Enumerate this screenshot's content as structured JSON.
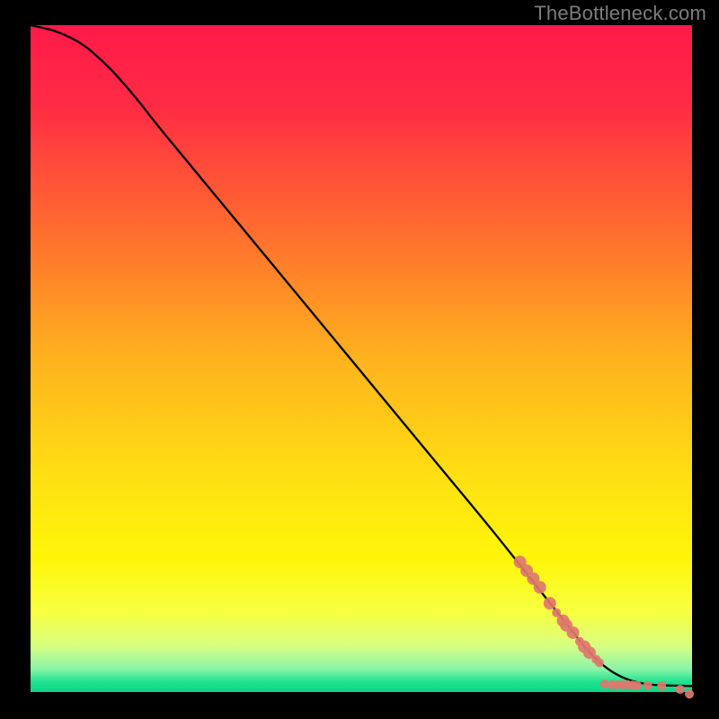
{
  "watermark": "TheBottleneck.com",
  "chart_data": {
    "type": "line",
    "title": "",
    "xlabel": "",
    "ylabel": "",
    "xlim": [
      0,
      100
    ],
    "ylim": [
      0,
      100
    ],
    "gradient_stops": [
      {
        "pos": 0.0,
        "color": "#ff1a4a"
      },
      {
        "pos": 0.12,
        "color": "#ff2b44"
      },
      {
        "pos": 0.3,
        "color": "#ff6a2f"
      },
      {
        "pos": 0.5,
        "color": "#ffb21e"
      },
      {
        "pos": 0.68,
        "color": "#ffe012"
      },
      {
        "pos": 0.8,
        "color": "#fff60a"
      },
      {
        "pos": 0.88,
        "color": "#f7ff40"
      },
      {
        "pos": 0.93,
        "color": "#d9ff80"
      },
      {
        "pos": 0.965,
        "color": "#8cf5a8"
      },
      {
        "pos": 0.985,
        "color": "#1de28f"
      },
      {
        "pos": 1.0,
        "color": "#0fd488"
      }
    ],
    "series": [
      {
        "name": "bottleneck-curve",
        "x": [
          0,
          4,
          8,
          12,
          16,
          20,
          30,
          40,
          50,
          60,
          70,
          78,
          82,
          84,
          86,
          88,
          90,
          92,
          94,
          96,
          98,
          100
        ],
        "y": [
          100,
          99,
          97,
          93.5,
          89,
          84,
          72,
          60,
          48,
          36,
          24,
          14,
          9,
          6.5,
          4.5,
          3,
          2,
          1.4,
          1.1,
          1.0,
          0.95,
          0.9
        ]
      }
    ],
    "highlight_points": {
      "name": "data-markers",
      "color": "#e0776d",
      "radius_small": 5,
      "radius_large": 7,
      "points": [
        {
          "x": 74,
          "y": 19.5,
          "r": 7
        },
        {
          "x": 75,
          "y": 18.2,
          "r": 7
        },
        {
          "x": 76,
          "y": 17.0,
          "r": 7
        },
        {
          "x": 77,
          "y": 15.7,
          "r": 7
        },
        {
          "x": 78.5,
          "y": 13.3,
          "r": 7
        },
        {
          "x": 79.5,
          "y": 11.9,
          "r": 5
        },
        {
          "x": 80.5,
          "y": 10.7,
          "r": 7
        },
        {
          "x": 81.0,
          "y": 10.0,
          "r": 7
        },
        {
          "x": 82.0,
          "y": 8.9,
          "r": 7
        },
        {
          "x": 83.0,
          "y": 7.6,
          "r": 5
        },
        {
          "x": 83.7,
          "y": 6.8,
          "r": 7
        },
        {
          "x": 84.5,
          "y": 5.9,
          "r": 7
        },
        {
          "x": 85.5,
          "y": 4.9,
          "r": 5
        },
        {
          "x": 86.0,
          "y": 4.4,
          "r": 5
        },
        {
          "x": 86.8,
          "y": 1.2,
          "r": 5
        },
        {
          "x": 87.9,
          "y": 1.1,
          "r": 5
        },
        {
          "x": 88.7,
          "y": 1.1,
          "r": 5
        },
        {
          "x": 89.5,
          "y": 1.1,
          "r": 5
        },
        {
          "x": 90.3,
          "y": 1.1,
          "r": 5
        },
        {
          "x": 91.0,
          "y": 1.05,
          "r": 5
        },
        {
          "x": 91.7,
          "y": 1.0,
          "r": 5
        },
        {
          "x": 93.3,
          "y": 1.0,
          "r": 5
        },
        {
          "x": 95.4,
          "y": 0.9,
          "r": 5
        },
        {
          "x": 98.2,
          "y": 0.4,
          "r": 5
        },
        {
          "x": 99.6,
          "y": -0.3,
          "r": 5
        }
      ]
    }
  }
}
